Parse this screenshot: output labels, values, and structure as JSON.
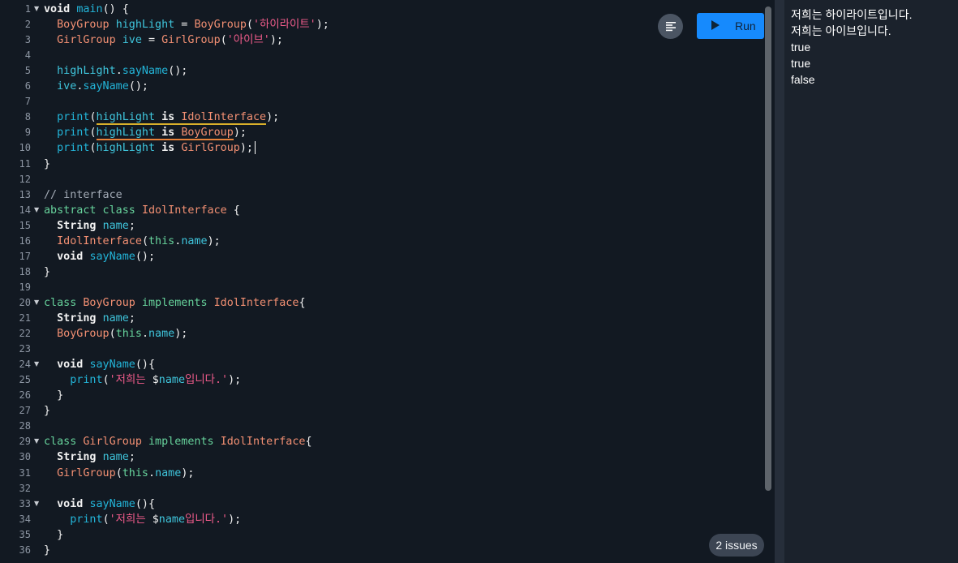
{
  "toolbar": {
    "format_icon": "format-align-icon",
    "run_icon": "play-icon",
    "run_label": "Run"
  },
  "editor": {
    "issues_label": "2 issues",
    "lines": [
      {
        "n": "1",
        "fold": true,
        "tokens": [
          {
            "t": "void ",
            "c": "kw"
          },
          {
            "t": "main",
            "c": "fn"
          },
          {
            "t": "() {",
            "c": "p"
          }
        ]
      },
      {
        "n": "2",
        "fold": false,
        "tokens": [
          {
            "t": "  "
          },
          {
            "t": "BoyGroup",
            "c": "cls"
          },
          {
            "t": " "
          },
          {
            "t": "highLight",
            "c": "var"
          },
          {
            "t": " = ",
            "c": "p"
          },
          {
            "t": "BoyGroup",
            "c": "cls"
          },
          {
            "t": "(",
            "c": "p"
          },
          {
            "t": "'하이라이트'",
            "c": "str"
          },
          {
            "t": ");",
            "c": "p"
          }
        ]
      },
      {
        "n": "3",
        "fold": false,
        "tokens": [
          {
            "t": "  "
          },
          {
            "t": "GirlGroup",
            "c": "cls"
          },
          {
            "t": " "
          },
          {
            "t": "ive",
            "c": "var"
          },
          {
            "t": " = ",
            "c": "p"
          },
          {
            "t": "GirlGroup",
            "c": "cls"
          },
          {
            "t": "(",
            "c": "p"
          },
          {
            "t": "'아이브'",
            "c": "str"
          },
          {
            "t": ");",
            "c": "p"
          }
        ]
      },
      {
        "n": "4",
        "fold": false,
        "tokens": []
      },
      {
        "n": "5",
        "fold": false,
        "tokens": [
          {
            "t": "  "
          },
          {
            "t": "highLight",
            "c": "var"
          },
          {
            "t": ".",
            "c": "p"
          },
          {
            "t": "sayName",
            "c": "fn"
          },
          {
            "t": "();",
            "c": "p"
          }
        ]
      },
      {
        "n": "6",
        "fold": false,
        "tokens": [
          {
            "t": "  "
          },
          {
            "t": "ive",
            "c": "var"
          },
          {
            "t": ".",
            "c": "p"
          },
          {
            "t": "sayName",
            "c": "fn"
          },
          {
            "t": "();",
            "c": "p"
          }
        ]
      },
      {
        "n": "7",
        "fold": false,
        "tokens": []
      },
      {
        "n": "8",
        "fold": false,
        "tokens": [
          {
            "t": "  "
          },
          {
            "t": "print",
            "c": "fn"
          },
          {
            "t": "(",
            "c": "p"
          },
          {
            "t": "highLight",
            "c": "var",
            "u": "info"
          },
          {
            "t": " is ",
            "c": "kw",
            "u": "info"
          },
          {
            "t": "IdolInterface",
            "c": "cls",
            "u": "info"
          },
          {
            "t": ");",
            "c": "p"
          }
        ]
      },
      {
        "n": "9",
        "fold": false,
        "tokens": [
          {
            "t": "  "
          },
          {
            "t": "print",
            "c": "fn"
          },
          {
            "t": "(",
            "c": "p"
          },
          {
            "t": "highLight",
            "c": "var",
            "u": "warn"
          },
          {
            "t": " is ",
            "c": "kw",
            "u": "warn"
          },
          {
            "t": "BoyGroup",
            "c": "cls",
            "u": "warn"
          },
          {
            "t": ");",
            "c": "p"
          }
        ]
      },
      {
        "n": "10",
        "fold": false,
        "caret": true,
        "tokens": [
          {
            "t": "  "
          },
          {
            "t": "print",
            "c": "fn"
          },
          {
            "t": "(",
            "c": "p"
          },
          {
            "t": "highLight",
            "c": "var"
          },
          {
            "t": " is ",
            "c": "kw"
          },
          {
            "t": "GirlGroup",
            "c": "cls"
          },
          {
            "t": ");",
            "c": "p"
          }
        ]
      },
      {
        "n": "11",
        "fold": false,
        "tokens": [
          {
            "t": "}",
            "c": "p"
          }
        ]
      },
      {
        "n": "12",
        "fold": false,
        "tokens": []
      },
      {
        "n": "13",
        "fold": false,
        "tokens": [
          {
            "t": "// interface",
            "c": "cm"
          }
        ]
      },
      {
        "n": "14",
        "fold": true,
        "tokens": [
          {
            "t": "abstract class ",
            "c": "mkw"
          },
          {
            "t": "IdolInterface",
            "c": "cls"
          },
          {
            "t": " {",
            "c": "p"
          }
        ]
      },
      {
        "n": "15",
        "fold": false,
        "tokens": [
          {
            "t": "  "
          },
          {
            "t": "String ",
            "c": "kw"
          },
          {
            "t": "name",
            "c": "var"
          },
          {
            "t": ";",
            "c": "p"
          }
        ]
      },
      {
        "n": "16",
        "fold": false,
        "tokens": [
          {
            "t": "  "
          },
          {
            "t": "IdolInterface",
            "c": "cls"
          },
          {
            "t": "(",
            "c": "p"
          },
          {
            "t": "this",
            "c": "mkw"
          },
          {
            "t": ".",
            "c": "p"
          },
          {
            "t": "name",
            "c": "var"
          },
          {
            "t": ");",
            "c": "p"
          }
        ]
      },
      {
        "n": "17",
        "fold": false,
        "tokens": [
          {
            "t": "  "
          },
          {
            "t": "void ",
            "c": "kw"
          },
          {
            "t": "sayName",
            "c": "fn"
          },
          {
            "t": "();",
            "c": "p"
          }
        ]
      },
      {
        "n": "18",
        "fold": false,
        "tokens": [
          {
            "t": "}",
            "c": "p"
          }
        ]
      },
      {
        "n": "19",
        "fold": false,
        "tokens": []
      },
      {
        "n": "20",
        "fold": true,
        "tokens": [
          {
            "t": "class ",
            "c": "mkw"
          },
          {
            "t": "BoyGroup",
            "c": "cls"
          },
          {
            "t": " implements ",
            "c": "mkw"
          },
          {
            "t": "IdolInterface",
            "c": "cls"
          },
          {
            "t": "{",
            "c": "p"
          }
        ]
      },
      {
        "n": "21",
        "fold": false,
        "tokens": [
          {
            "t": "  "
          },
          {
            "t": "String ",
            "c": "kw"
          },
          {
            "t": "name",
            "c": "var"
          },
          {
            "t": ";",
            "c": "p"
          }
        ]
      },
      {
        "n": "22",
        "fold": false,
        "tokens": [
          {
            "t": "  "
          },
          {
            "t": "BoyGroup",
            "c": "cls"
          },
          {
            "t": "(",
            "c": "p"
          },
          {
            "t": "this",
            "c": "mkw"
          },
          {
            "t": ".",
            "c": "p"
          },
          {
            "t": "name",
            "c": "var"
          },
          {
            "t": ");",
            "c": "p"
          }
        ]
      },
      {
        "n": "23",
        "fold": false,
        "tokens": []
      },
      {
        "n": "24",
        "fold": true,
        "tokens": [
          {
            "t": "  "
          },
          {
            "t": "void ",
            "c": "kw"
          },
          {
            "t": "sayName",
            "c": "fn"
          },
          {
            "t": "(){",
            "c": "p"
          }
        ]
      },
      {
        "n": "25",
        "fold": false,
        "tokens": [
          {
            "t": "    "
          },
          {
            "t": "print",
            "c": "fn"
          },
          {
            "t": "(",
            "c": "p"
          },
          {
            "t": "'저희는 ",
            "c": "str"
          },
          {
            "t": "$",
            "c": "p"
          },
          {
            "t": "name",
            "c": "var"
          },
          {
            "t": "입니다.'",
            "c": "str"
          },
          {
            "t": ");",
            "c": "p"
          }
        ]
      },
      {
        "n": "26",
        "fold": false,
        "tokens": [
          {
            "t": "  "
          },
          {
            "t": "}",
            "c": "p"
          }
        ]
      },
      {
        "n": "27",
        "fold": false,
        "tokens": [
          {
            "t": "}",
            "c": "p"
          }
        ]
      },
      {
        "n": "28",
        "fold": false,
        "tokens": []
      },
      {
        "n": "29",
        "fold": true,
        "tokens": [
          {
            "t": "class ",
            "c": "mkw"
          },
          {
            "t": "GirlGroup",
            "c": "cls"
          },
          {
            "t": " implements ",
            "c": "mkw"
          },
          {
            "t": "IdolInterface",
            "c": "cls"
          },
          {
            "t": "{",
            "c": "p"
          }
        ]
      },
      {
        "n": "30",
        "fold": false,
        "tokens": [
          {
            "t": "  "
          },
          {
            "t": "String ",
            "c": "kw"
          },
          {
            "t": "name",
            "c": "var"
          },
          {
            "t": ";",
            "c": "p"
          }
        ]
      },
      {
        "n": "31",
        "fold": false,
        "tokens": [
          {
            "t": "  "
          },
          {
            "t": "GirlGroup",
            "c": "cls"
          },
          {
            "t": "(",
            "c": "p"
          },
          {
            "t": "this",
            "c": "mkw"
          },
          {
            "t": ".",
            "c": "p"
          },
          {
            "t": "name",
            "c": "var"
          },
          {
            "t": ");",
            "c": "p"
          }
        ]
      },
      {
        "n": "32",
        "fold": false,
        "tokens": []
      },
      {
        "n": "33",
        "fold": true,
        "tokens": [
          {
            "t": "  "
          },
          {
            "t": "void ",
            "c": "kw"
          },
          {
            "t": "sayName",
            "c": "fn"
          },
          {
            "t": "(){",
            "c": "p"
          }
        ]
      },
      {
        "n": "34",
        "fold": false,
        "tokens": [
          {
            "t": "    "
          },
          {
            "t": "print",
            "c": "fn"
          },
          {
            "t": "(",
            "c": "p"
          },
          {
            "t": "'저희는 ",
            "c": "str"
          },
          {
            "t": "$",
            "c": "p"
          },
          {
            "t": "name",
            "c": "var"
          },
          {
            "t": "입니다.'",
            "c": "str"
          },
          {
            "t": ");",
            "c": "p"
          }
        ]
      },
      {
        "n": "35",
        "fold": false,
        "tokens": [
          {
            "t": "  "
          },
          {
            "t": "}",
            "c": "p"
          }
        ]
      },
      {
        "n": "36",
        "fold": false,
        "tokens": [
          {
            "t": "}",
            "c": "p"
          }
        ]
      }
    ]
  },
  "console": {
    "lines": [
      "저희는 하이라이트입니다.",
      "저희는 아이브입니다.",
      "true",
      "true",
      "false"
    ]
  },
  "colors": {
    "editor_bg": "#121922",
    "console_bg": "#1b222c",
    "run_button": "#168afd",
    "keyword": "#f2f2f2",
    "function": "#23b5d9",
    "class": "#f39073",
    "string": "#f25c8c",
    "modifier": "#67d39c"
  }
}
